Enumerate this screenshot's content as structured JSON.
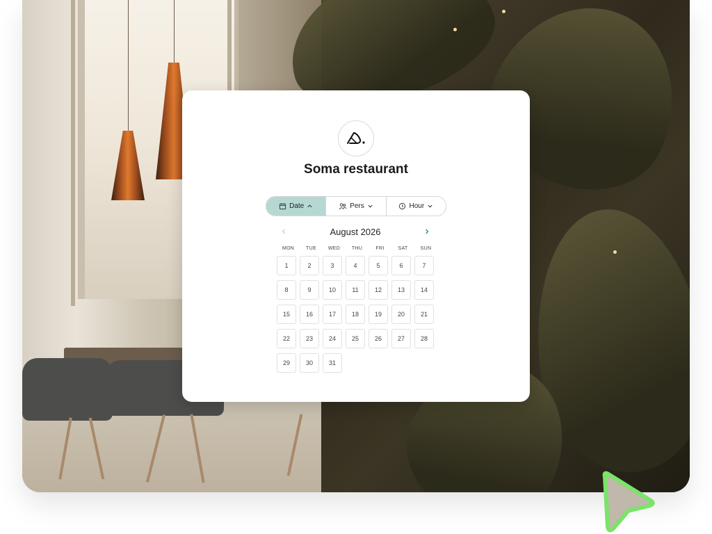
{
  "restaurant": {
    "name": "Soma restaurant"
  },
  "tabs": [
    {
      "label": "Date",
      "icon": "calendar-icon",
      "state": "expanded"
    },
    {
      "label": "Pers",
      "icon": "people-icon",
      "state": "collapsed"
    },
    {
      "label": "Hour",
      "icon": "clock-icon",
      "state": "collapsed"
    }
  ],
  "calendar": {
    "month_label": "August 2026",
    "weekdays": [
      "MON",
      "TUE",
      "WED",
      "THU",
      "FRI",
      "SAT",
      "SUN"
    ],
    "days": [
      "1",
      "2",
      "3",
      "4",
      "5",
      "6",
      "7",
      "8",
      "9",
      "10",
      "11",
      "12",
      "13",
      "14",
      "15",
      "16",
      "17",
      "18",
      "19",
      "20",
      "21",
      "22",
      "23",
      "24",
      "25",
      "26",
      "27",
      "28",
      "29",
      "30",
      "31"
    ]
  },
  "colors": {
    "active_tab": "#b6d8d3",
    "cursor": "#7be36a"
  }
}
